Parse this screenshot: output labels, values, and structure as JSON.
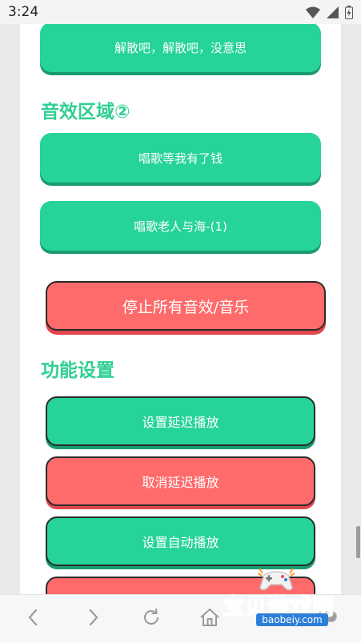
{
  "status_bar": {
    "time": "3:24"
  },
  "buttons_top": [
    {
      "label": "解散吧，解散吧，没意思"
    }
  ],
  "sections": {
    "sound2": {
      "title": "音效区域②"
    },
    "settings": {
      "title": "功能设置"
    }
  },
  "sound_buttons": [
    {
      "label": "唱歌等我有了钱"
    },
    {
      "label": "唱歌老人与海-(1)"
    }
  ],
  "stop_all": {
    "label": "停止所有音效/音乐"
  },
  "function_buttons": [
    {
      "label": "设置延迟播放",
      "color": "#26d399"
    },
    {
      "label": "取消延迟播放",
      "color": "#ff6b6b"
    },
    {
      "label": "设置自动播放",
      "color": "#26d399"
    },
    {
      "label": "",
      "color": "#ff6b6b"
    }
  ],
  "watermark": {
    "name": "宝贝游戏网",
    "url": "baobeiy.com"
  },
  "colors": {
    "accent_green": "#26d399",
    "accent_red": "#ff6b6b",
    "title_green": "#2fcf93"
  }
}
